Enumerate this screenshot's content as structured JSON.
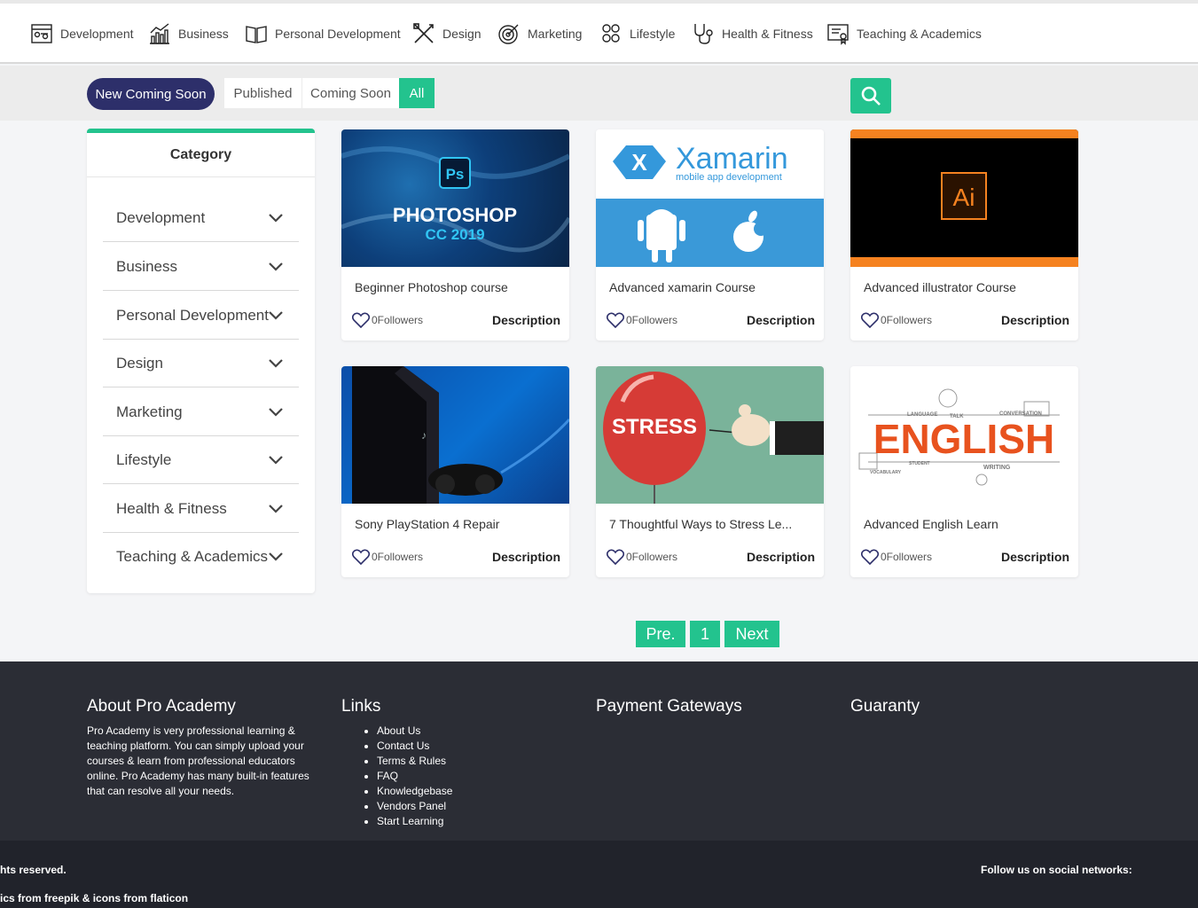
{
  "topnav": {
    "items": [
      {
        "label": "Development",
        "icon": "development-icon"
      },
      {
        "label": "Business",
        "icon": "business-icon"
      },
      {
        "label": "Personal Development",
        "icon": "book-icon"
      },
      {
        "label": "Design",
        "icon": "design-tools-icon"
      },
      {
        "label": "Marketing",
        "icon": "target-icon"
      },
      {
        "label": "Lifestyle",
        "icon": "lifestyle-icon"
      },
      {
        "label": "Health & Fitness",
        "icon": "stethoscope-icon"
      },
      {
        "label": "Teaching & Academics",
        "icon": "certificate-icon"
      }
    ]
  },
  "filters": {
    "new_coming_soon": "New Coming Soon",
    "published": "Published",
    "coming_soon": "Coming Soon",
    "all": "All",
    "active": "All"
  },
  "sidebar": {
    "title": "Category",
    "items": [
      "Development",
      "Business",
      "Personal Development",
      "Design",
      "Marketing",
      "Lifestyle",
      "Health & Fitness",
      "Teaching & Academics"
    ]
  },
  "courses": [
    {
      "title": "Beginner Photoshop course",
      "followers": "0Followers",
      "action": "Description",
      "image_text": [
        "Ps",
        "PHOTOSHOP",
        "CC 2019"
      ]
    },
    {
      "title": "Advanced xamarin Course",
      "followers": "0Followers",
      "action": "Description",
      "image_text": [
        "Xamarin",
        "mobile app development"
      ]
    },
    {
      "title": "Advanced illustrator Course",
      "followers": "0Followers",
      "action": "Description",
      "image_text": [
        "Ai"
      ]
    },
    {
      "title": "Sony PlayStation 4 Repair",
      "followers": "0Followers",
      "action": "Description",
      "image_text": []
    },
    {
      "title": "7 Thoughtful Ways to Stress Le...",
      "followers": "0Followers",
      "action": "Description",
      "image_text": [
        "STRESS"
      ]
    },
    {
      "title": "Advanced English Learn",
      "followers": "0Followers",
      "action": "Description",
      "image_text": [
        "ENGLISH",
        "CONVERSATION",
        "LANGUAGE",
        "TALK",
        "WRITING",
        "STUDENT",
        "VOCABULARY"
      ]
    }
  ],
  "pagination": {
    "prev": "Pre.",
    "current": "1",
    "next": "Next"
  },
  "footer": {
    "about_title": "About Pro Academy",
    "about_text": "Pro Academy is very professional learning & teaching platform. You can simply upload your courses & learn from professional educators online. Pro Academy has many built-in features that can resolve all your needs.",
    "links_title": "Links",
    "links": [
      "About Us",
      "Contact Us",
      "Terms & Rules",
      "FAQ",
      "Knowledgebase",
      "Vendors Panel",
      "Start Learning"
    ],
    "payment_title": "Payment Gateways",
    "guaranty_title": "Guaranty",
    "rights": "hts reserved.",
    "credits": "ics from freepik & icons from flaticon",
    "social": "Follow us on social networks:"
  },
  "colors": {
    "accent": "#23c38e",
    "navy": "#2d2f6a",
    "footer": "#2b2d35",
    "footer_bottom": "#21232b"
  }
}
